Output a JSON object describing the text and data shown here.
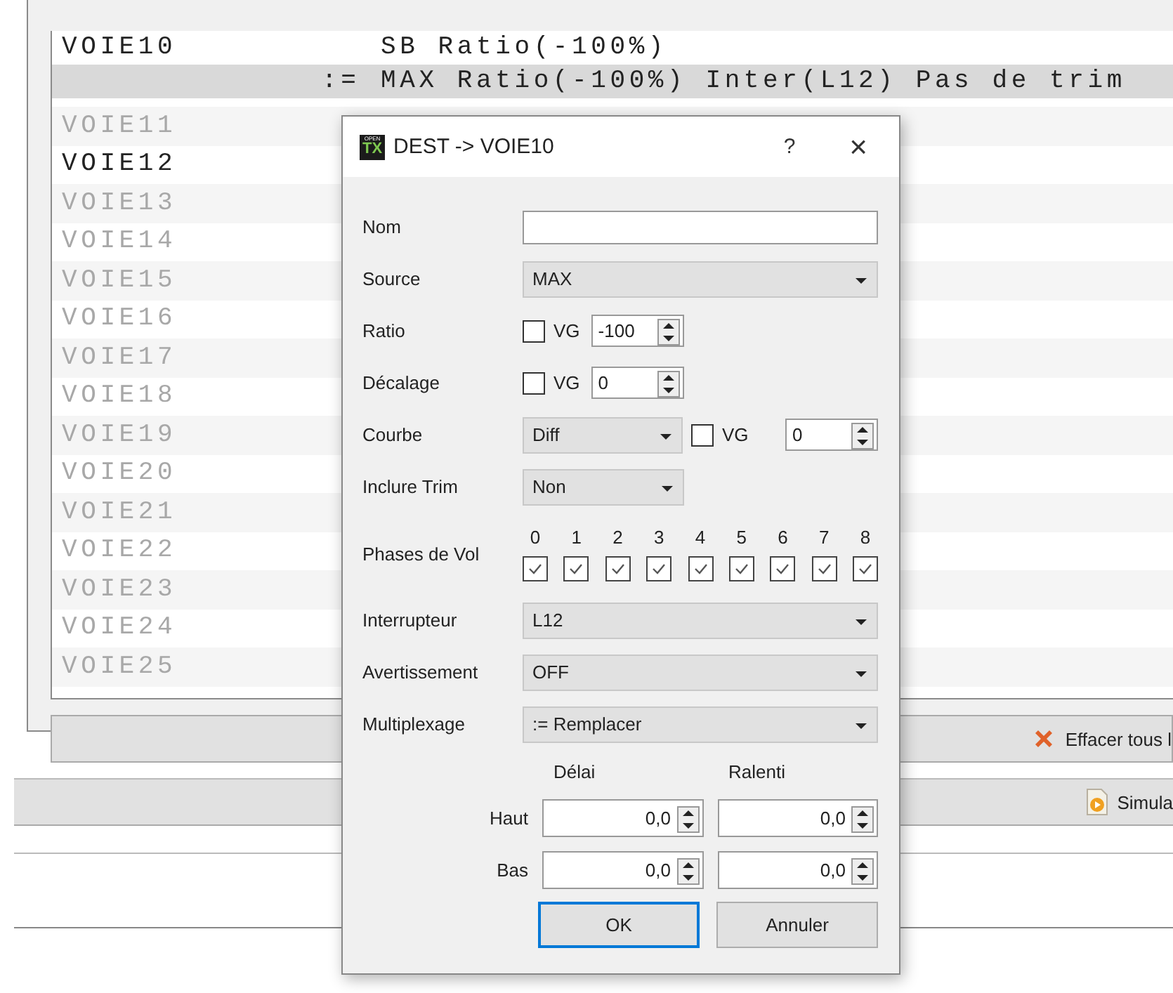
{
  "list": {
    "rows": [
      {
        "name": "VOIE10",
        "used": true,
        "lines": [
          {
            "text": "SB Ratio(-100%)",
            "selected": false
          },
          {
            "operator": ":=",
            "text": "MAX Ratio(-100%) Inter(L12) Pas de trim",
            "selected": true
          }
        ]
      },
      {
        "name": "VOIE11",
        "used": false
      },
      {
        "name": "VOIE12",
        "used": true
      },
      {
        "name": "VOIE13",
        "used": false
      },
      {
        "name": "VOIE14",
        "used": false
      },
      {
        "name": "VOIE15",
        "used": false
      },
      {
        "name": "VOIE16",
        "used": false
      },
      {
        "name": "VOIE17",
        "used": false
      },
      {
        "name": "VOIE18",
        "used": false
      },
      {
        "name": "VOIE19",
        "used": false
      },
      {
        "name": "VOIE20",
        "used": false
      },
      {
        "name": "VOIE21",
        "used": false
      },
      {
        "name": "VOIE22",
        "used": false
      },
      {
        "name": "VOIE23",
        "used": false
      },
      {
        "name": "VOIE24",
        "used": false
      },
      {
        "name": "VOIE25",
        "used": false
      }
    ]
  },
  "clear_button": {
    "label": "Effacer tous l"
  },
  "simulate_button": {
    "label": "Simula"
  },
  "dialog": {
    "title": "DEST -> VOIE10",
    "help": "?",
    "close": "×",
    "logo_top": "OPEN",
    "logo_bottom": "TX",
    "fields": [
      {
        "kind": "text",
        "label": "Nom"
      },
      {
        "kind": "combo",
        "label": "Source",
        "value": "MAX"
      },
      {
        "kind": "gvar",
        "label": "Ratio",
        "gv_label": "VG",
        "checked": false,
        "value": "-100"
      },
      {
        "kind": "gvar",
        "label": "Décalage",
        "gv_label": "VG",
        "checked": false,
        "value": "0"
      },
      {
        "kind": "curve",
        "label": "Courbe",
        "value": "Diff",
        "gv_label": "VG",
        "checked": false,
        "spin": "0"
      },
      {
        "kind": "short",
        "label": "Inclure Trim",
        "value": "Non"
      },
      {
        "kind": "phases",
        "label": "Phases de Vol",
        "phases": [
          {
            "label": "0",
            "checked": true
          },
          {
            "label": "1",
            "checked": true
          },
          {
            "label": "2",
            "checked": true
          },
          {
            "label": "3",
            "checked": true
          },
          {
            "label": "4",
            "checked": true
          },
          {
            "label": "5",
            "checked": true
          },
          {
            "label": "6",
            "checked": true
          },
          {
            "label": "7",
            "checked": true
          },
          {
            "label": "8",
            "checked": true
          }
        ]
      },
      {
        "kind": "combo",
        "label": "Interrupteur",
        "value": "L12"
      },
      {
        "kind": "combo",
        "label": "Avertissement",
        "value": "OFF"
      },
      {
        "kind": "combo",
        "label": "Multiplexage",
        "value": ":= Remplacer"
      }
    ],
    "timing": {
      "headers": [
        "Délai",
        "Ralenti"
      ],
      "rows": [
        {
          "label": "Haut",
          "values": [
            "0,0",
            "0,0"
          ]
        },
        {
          "label": "Bas",
          "values": [
            "0,0",
            "0,0"
          ]
        }
      ]
    },
    "buttons": [
      {
        "label": "OK",
        "default": true
      },
      {
        "label": "Annuler",
        "default": false
      }
    ]
  }
}
